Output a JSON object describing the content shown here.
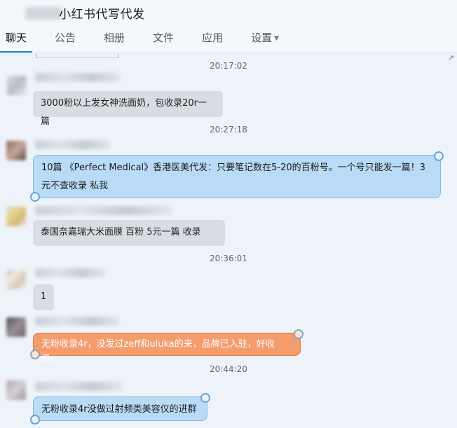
{
  "window": {
    "title": "小红书代写代发"
  },
  "tabs": [
    {
      "label": "聊天"
    },
    {
      "label": "公告"
    },
    {
      "label": "相册"
    },
    {
      "label": "文件"
    },
    {
      "label": "应用"
    },
    {
      "label": "设置"
    }
  ],
  "timestamps": [
    "20:17:02",
    "20:27:18",
    "20:36:01",
    "20:44:20"
  ],
  "messages": [
    {
      "text": "3000粉以上发女神洗面奶，包收录20r一篇"
    },
    {
      "text": "10篇 《Perfect  Medical》香港医美代发：只要笔记数在5-20的百粉号。一个号只能发一篇！3元不查收录  私我"
    },
    {
      "text": "泰国奈嘉瑞大米面膜   百粉  5元一篇     收录"
    },
    {
      "text": "1"
    },
    {
      "text": "无粉收录4r，没发过zeff和uluka的来，品牌已入驻，好收录。"
    },
    {
      "text": "无粉收录4r没做过射频类美容仪的进群"
    }
  ],
  "colors": {
    "accent": "#1e88d6",
    "bubble_gray": "#d9dde3",
    "bubble_blue": "#b9dbf7",
    "bubble_orange": "#f59c6c"
  }
}
